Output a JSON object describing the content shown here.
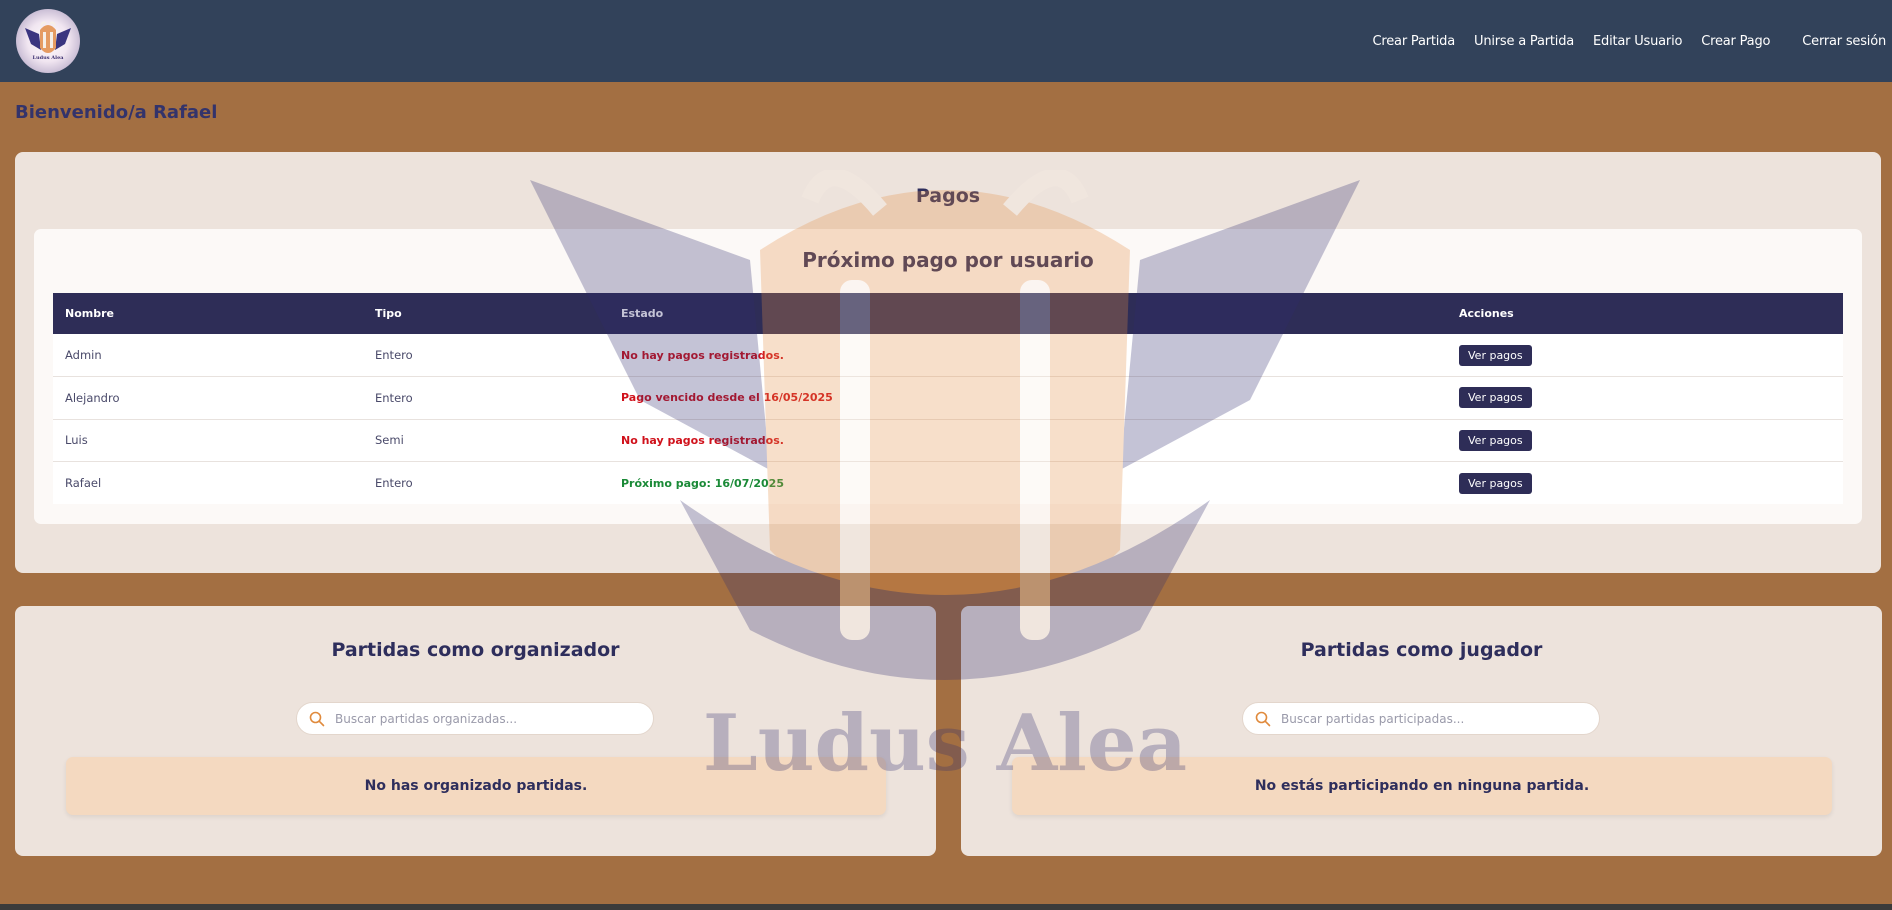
{
  "header": {
    "logo_text": "Ludus Alea",
    "nav": {
      "crear_partida": "Crear Partida",
      "unirse_partida": "Unirse a Partida",
      "editar_usuario": "Editar Usuario",
      "crear_pago": "Crear Pago",
      "cerrar_sesion": "Cerrar sesión"
    }
  },
  "welcome": "Bienvenido/a Rafael",
  "watermark_text": "Ludus Alea",
  "pagos": {
    "title": "Pagos",
    "subtitle": "Próximo pago por usuario",
    "columns": [
      "Nombre",
      "Tipo",
      "Estado",
      "Acciones"
    ],
    "rows": [
      {
        "nombre": "Admin",
        "tipo": "Entero",
        "estado": "No hay pagos registrados.",
        "estado_color": "#d0111b",
        "accion": "Ver pagos"
      },
      {
        "nombre": "Alejandro",
        "tipo": "Entero",
        "estado": "Pago vencido desde el 16/05/2025",
        "estado_color": "#d0111b",
        "accion": "Ver pagos"
      },
      {
        "nombre": "Luis",
        "tipo": "Semi",
        "estado": "No hay pagos registrados.",
        "estado_color": "#d0111b",
        "accion": "Ver pagos"
      },
      {
        "nombre": "Rafael",
        "tipo": "Entero",
        "estado": "Próximo pago: 16/07/2025",
        "estado_color": "#1a8a37",
        "accion": "Ver pagos"
      }
    ]
  },
  "organizador": {
    "title": "Partidas como organizador",
    "search_placeholder": "Buscar partidas organizadas...",
    "search_value": "",
    "empty": "No has organizado partidas."
  },
  "jugador": {
    "title": "Partidas como jugador",
    "search_placeholder": "Buscar partidas participadas...",
    "search_value": "",
    "empty": "No estás participando en ninguna partida."
  },
  "colors": {
    "header_bg": "#32425a",
    "page_bg": "#a36f42",
    "accent_dark": "#2e2d57",
    "error": "#d0111b",
    "success": "#1a8a37",
    "search_icon": "#e08a3c"
  }
}
